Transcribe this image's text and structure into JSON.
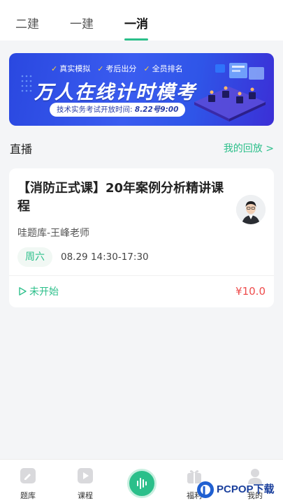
{
  "top_tabs": [
    {
      "label": "二建",
      "active": false
    },
    {
      "label": "一建",
      "active": false
    },
    {
      "label": "一消",
      "active": true
    }
  ],
  "banner": {
    "features": [
      "真实模拟",
      "考后出分",
      "全员排名"
    ],
    "title": "万人在线计时模考",
    "time_prefix": "技术实务考试开放时间:",
    "time_value": "8.22号9:00"
  },
  "live": {
    "section_title": "直播",
    "replay_link": "我的回放 >",
    "course": {
      "title": "【消防正式课】20年案例分析精讲课程",
      "teacher": "哇题库-王峰老师",
      "day": "周六",
      "datetime": "08.29  14:30-17:30",
      "status": "未开始",
      "price": "¥10.0"
    }
  },
  "bottom_nav": {
    "items": [
      "题库",
      "课程",
      "",
      "福利",
      "我的"
    ]
  },
  "watermark": {
    "brand": "PCPOP下载"
  },
  "colors": {
    "accent": "#2bbf8a",
    "price": "#ee4c4c",
    "banner": "#3a5cf0"
  }
}
